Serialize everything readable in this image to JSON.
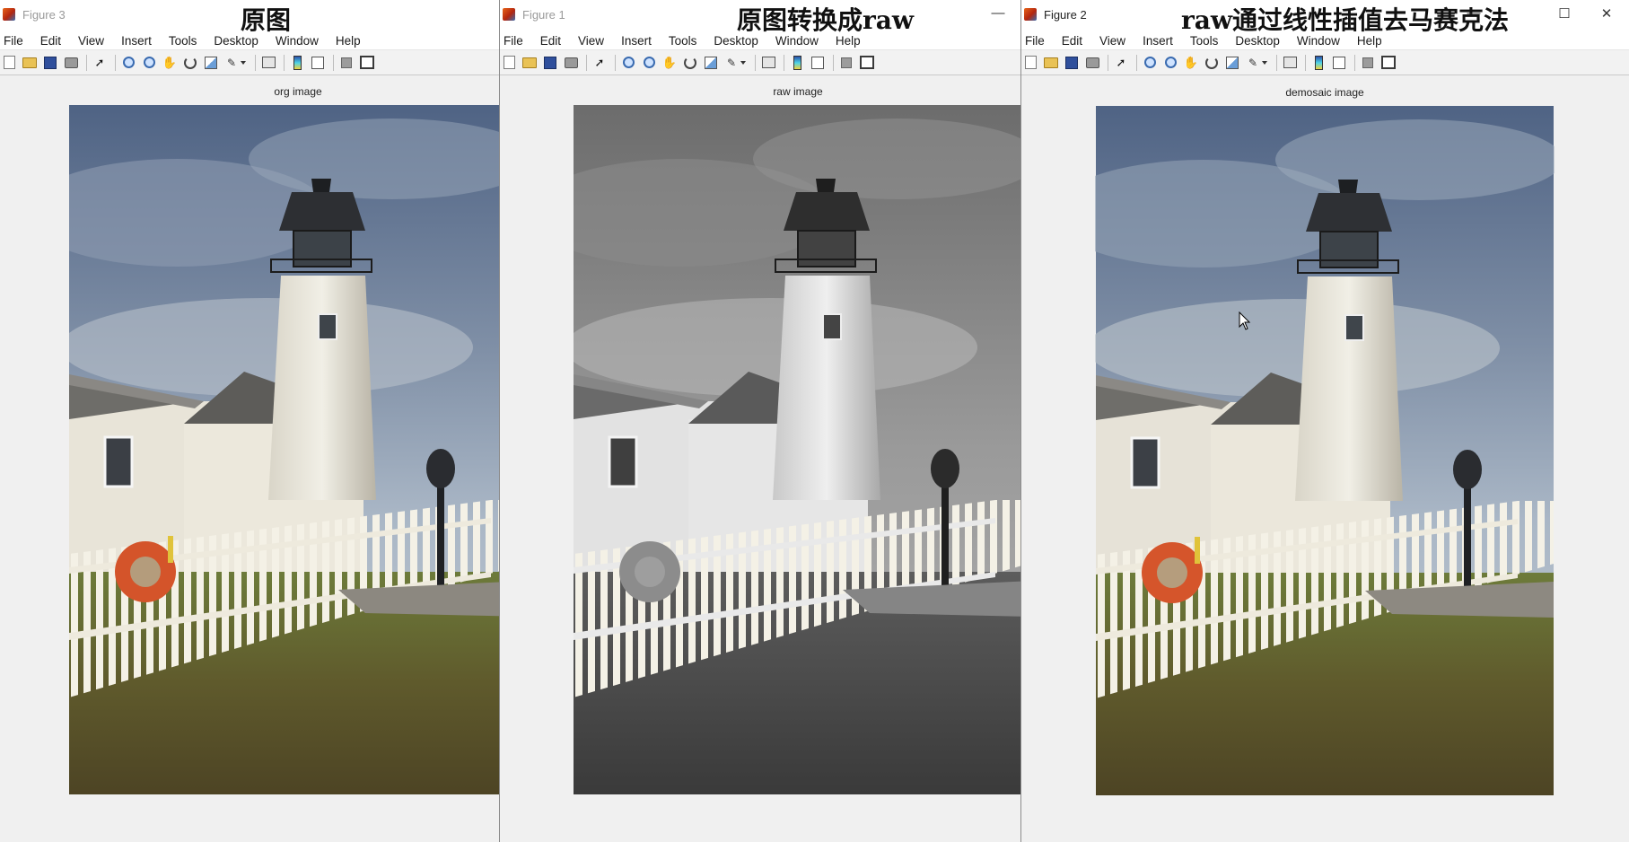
{
  "menu": [
    "File",
    "Edit",
    "View",
    "Insert",
    "Tools",
    "Desktop",
    "Window",
    "Help"
  ],
  "windows": [
    {
      "id": "win3",
      "title": "Figure 3",
      "overlay": "原图",
      "axes_title": "org image",
      "mode": "color"
    },
    {
      "id": "win1",
      "title": "Figure 1",
      "overlay": "原图转换成raw",
      "axes_title": "raw image",
      "mode": "gray"
    },
    {
      "id": "win2",
      "title": "Figure 2",
      "overlay": "raw通过线性插值去马赛克法",
      "axes_title": "demosaic image",
      "mode": "color"
    }
  ],
  "window_buttons": {
    "minimize": "—",
    "maximize": "☐",
    "close": "✕"
  },
  "toolbar_icons": [
    "new-figure",
    "open-file",
    "save-figure",
    "print-figure",
    "edit-plot",
    "zoom-in",
    "zoom-out",
    "pan",
    "rotate-3d",
    "data-cursor",
    "brush",
    "link-plot",
    "insert-colorbar",
    "insert-legend",
    "hide-plot-tools",
    "show-plot-tools"
  ]
}
